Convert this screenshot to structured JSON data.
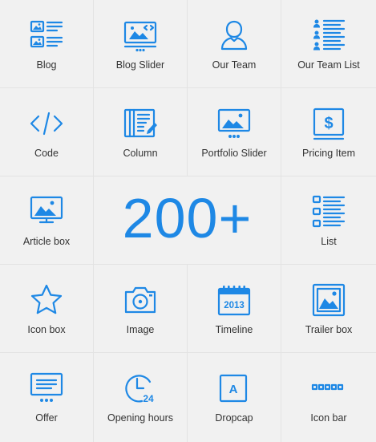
{
  "accent_color": "#1e88e5",
  "elements": [
    {
      "id": "blog",
      "label": "Blog",
      "icon": "blog-icon"
    },
    {
      "id": "blog-slider",
      "label": "Blog Slider",
      "icon": "blog-slider-icon"
    },
    {
      "id": "our-team",
      "label": "Our Team",
      "icon": "person-icon"
    },
    {
      "id": "our-team-list",
      "label": "Our Team List",
      "icon": "team-list-icon"
    },
    {
      "id": "code",
      "label": "Code",
      "icon": "code-icon"
    },
    {
      "id": "column",
      "label": "Column",
      "icon": "column-icon"
    },
    {
      "id": "portfolio-slider",
      "label": "Portfolio Slider",
      "icon": "portfolio-slider-icon"
    },
    {
      "id": "pricing-item",
      "label": "Pricing Item",
      "icon": "dollar-icon"
    },
    {
      "id": "article-box",
      "label": "Article box",
      "icon": "monitor-image-icon"
    },
    {
      "id": "list",
      "label": "List",
      "icon": "list-icon"
    },
    {
      "id": "icon-box",
      "label": "Icon box",
      "icon": "star-icon"
    },
    {
      "id": "image",
      "label": "Image",
      "icon": "camera-icon"
    },
    {
      "id": "timeline",
      "label": "Timeline",
      "icon": "calendar-icon",
      "icon_text": "2013"
    },
    {
      "id": "trailer-box",
      "label": "Trailer box",
      "icon": "image-frame-icon"
    },
    {
      "id": "offer",
      "label": "Offer",
      "icon": "offer-slides-icon"
    },
    {
      "id": "opening-hours",
      "label": "Opening hours",
      "icon": "clock-icon",
      "icon_text": "24"
    },
    {
      "id": "dropcap",
      "label": "Dropcap",
      "icon": "dropcap-icon",
      "icon_text": "A"
    },
    {
      "id": "icon-bar",
      "label": "Icon bar",
      "icon": "icon-bar-icon"
    }
  ],
  "highlight": {
    "count": "200+"
  }
}
